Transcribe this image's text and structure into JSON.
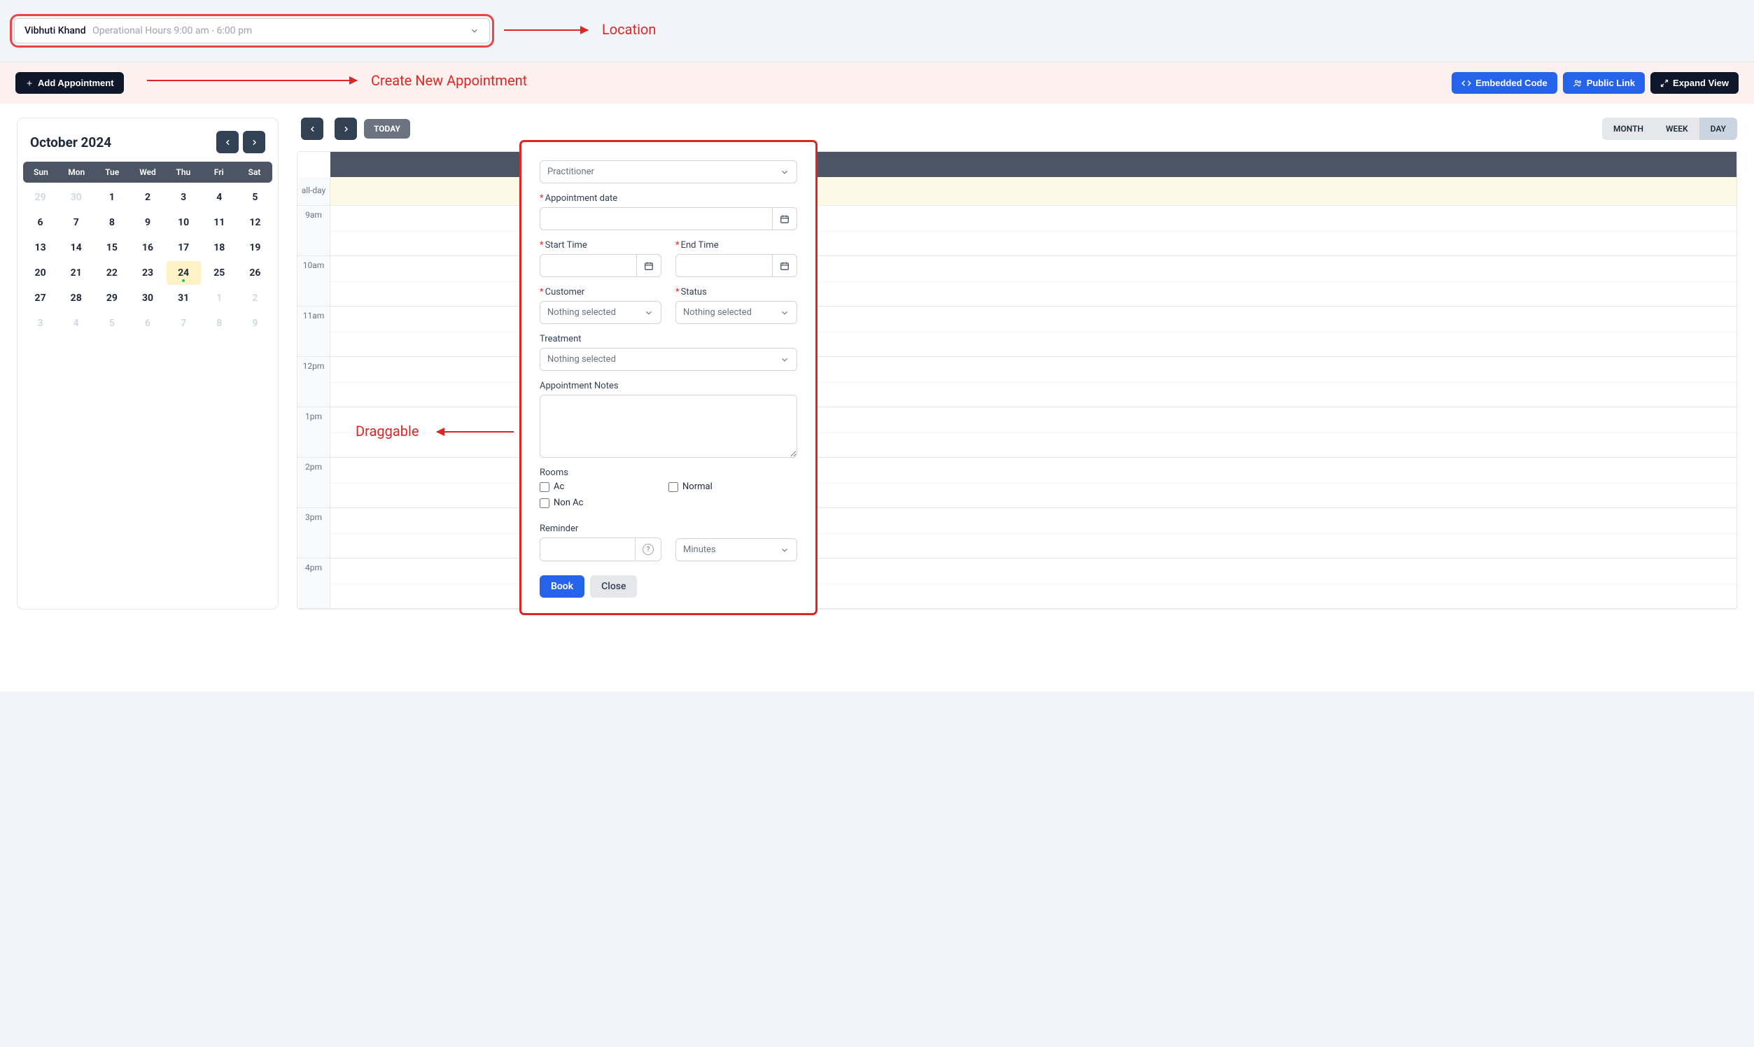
{
  "top": {
    "location_name": "Vibhuti Khand",
    "operational_hours": "Operational Hours 9:00 am - 6:00 pm"
  },
  "annotations": {
    "location": "Location",
    "create_new": "Create New Appointment",
    "draggable": "Draggable"
  },
  "toolbar": {
    "add_appointment": "Add Appointment",
    "embedded_code": "Embedded Code",
    "public_link": "Public Link",
    "expand_view": "Expand View"
  },
  "minical": {
    "title": "October 2024",
    "dow": [
      "Sun",
      "Mon",
      "Tue",
      "Wed",
      "Thu",
      "Fri",
      "Sat"
    ],
    "weeks": [
      [
        {
          "d": "29",
          "m": true
        },
        {
          "d": "30",
          "m": true
        },
        {
          "d": "1"
        },
        {
          "d": "2"
        },
        {
          "d": "3"
        },
        {
          "d": "4"
        },
        {
          "d": "5"
        }
      ],
      [
        {
          "d": "6"
        },
        {
          "d": "7"
        },
        {
          "d": "8"
        },
        {
          "d": "9"
        },
        {
          "d": "10"
        },
        {
          "d": "11"
        },
        {
          "d": "12"
        }
      ],
      [
        {
          "d": "13"
        },
        {
          "d": "14"
        },
        {
          "d": "15"
        },
        {
          "d": "16"
        },
        {
          "d": "17"
        },
        {
          "d": "18"
        },
        {
          "d": "19"
        }
      ],
      [
        {
          "d": "20"
        },
        {
          "d": "21"
        },
        {
          "d": "22"
        },
        {
          "d": "23"
        },
        {
          "d": "24",
          "today": true
        },
        {
          "d": "25"
        },
        {
          "d": "26"
        }
      ],
      [
        {
          "d": "27"
        },
        {
          "d": "28"
        },
        {
          "d": "29"
        },
        {
          "d": "30"
        },
        {
          "d": "31"
        },
        {
          "d": "1",
          "m": true
        },
        {
          "d": "2",
          "m": true
        }
      ],
      [
        {
          "d": "3",
          "m": true
        },
        {
          "d": "4",
          "m": true
        },
        {
          "d": "5",
          "m": true
        },
        {
          "d": "6",
          "m": true
        },
        {
          "d": "7",
          "m": true
        },
        {
          "d": "8",
          "m": true
        },
        {
          "d": "9",
          "m": true
        }
      ]
    ]
  },
  "sched": {
    "today": "TODAY",
    "views": {
      "month": "MONTH",
      "week": "WEEK",
      "day": "DAY"
    },
    "active_view": "day",
    "allday_label": "all-day",
    "times": [
      "9am",
      "10am",
      "11am",
      "12pm",
      "1pm",
      "2pm",
      "3pm",
      "4pm"
    ]
  },
  "form": {
    "practitioner_placeholder": "Practitioner",
    "labels": {
      "appointment_date": "Appointment date",
      "start_time": "Start Time",
      "end_time": "End Time",
      "customer": "Customer",
      "status": "Status",
      "treatment": "Treatment",
      "notes": "Appointment Notes",
      "rooms": "Rooms",
      "reminder": "Reminder"
    },
    "nothing_selected": "Nothing selected",
    "rooms": {
      "ac": "Ac",
      "normal": "Normal",
      "non_ac": "Non Ac"
    },
    "reminder_unit": "Minutes",
    "book": "Book",
    "close": "Close"
  }
}
